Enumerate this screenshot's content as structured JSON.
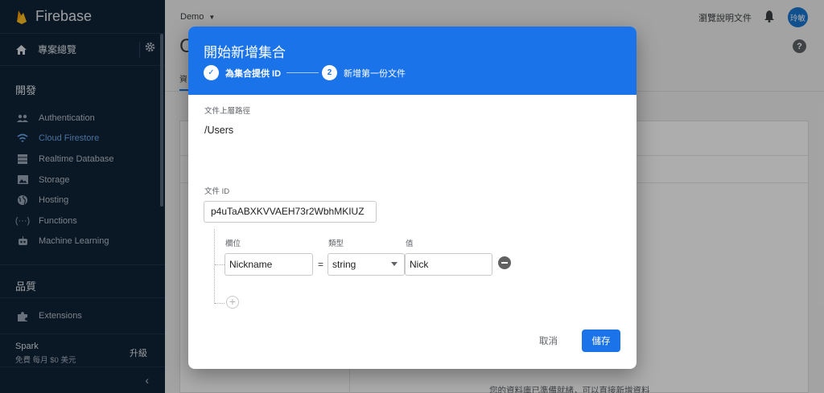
{
  "app": {
    "name": "Firebase",
    "project": "Demo"
  },
  "sidebar": {
    "overview": "專案總覽",
    "develop_section": "開發",
    "items": [
      {
        "label": "Authentication",
        "icon": "people-icon",
        "active": false
      },
      {
        "label": "Cloud Firestore",
        "icon": "wifi-icon",
        "active": true
      },
      {
        "label": "Realtime Database",
        "icon": "database-icon",
        "active": false
      },
      {
        "label": "Storage",
        "icon": "image-icon",
        "active": false
      },
      {
        "label": "Hosting",
        "icon": "globe-icon",
        "active": false
      },
      {
        "label": "Functions",
        "icon": "functions-icon",
        "active": false
      },
      {
        "label": "Machine Learning",
        "icon": "robot-icon",
        "active": false
      }
    ],
    "quality_section": "品質",
    "extensions": "Extensions",
    "plan": {
      "name": "Spark",
      "desc": "免費 每月 $0 美元",
      "upgrade": "升級"
    }
  },
  "topbar": {
    "docs": "瀏覽說明文件",
    "avatar": "玲敏"
  },
  "background": {
    "page_title": "C",
    "tab": "資",
    "hint": "您的資料庫已準備就緒，可以直接新增資料"
  },
  "dialog": {
    "title": "開始新增集合",
    "steps": [
      {
        "num": "✓",
        "label": "為集合提供 ID",
        "done": true
      },
      {
        "num": "2",
        "label": "新增第一份文件",
        "done": false
      }
    ],
    "parent_path_label": "文件上層路徑",
    "parent_path": "/Users",
    "doc_id_label": "文件 ID",
    "doc_id": "p4uTaABXKVVAEH73r2WbhMKIUZ",
    "columns": {
      "field": "欄位",
      "type": "類型",
      "value": "值"
    },
    "row": {
      "field": "Nickname",
      "type": "string",
      "value": "Nick"
    },
    "cancel": "取消",
    "save": "儲存"
  },
  "colors": {
    "accent": "#1a73e8",
    "sidebar_bg": "#0f2236",
    "active_item": "#6aa8ea"
  }
}
